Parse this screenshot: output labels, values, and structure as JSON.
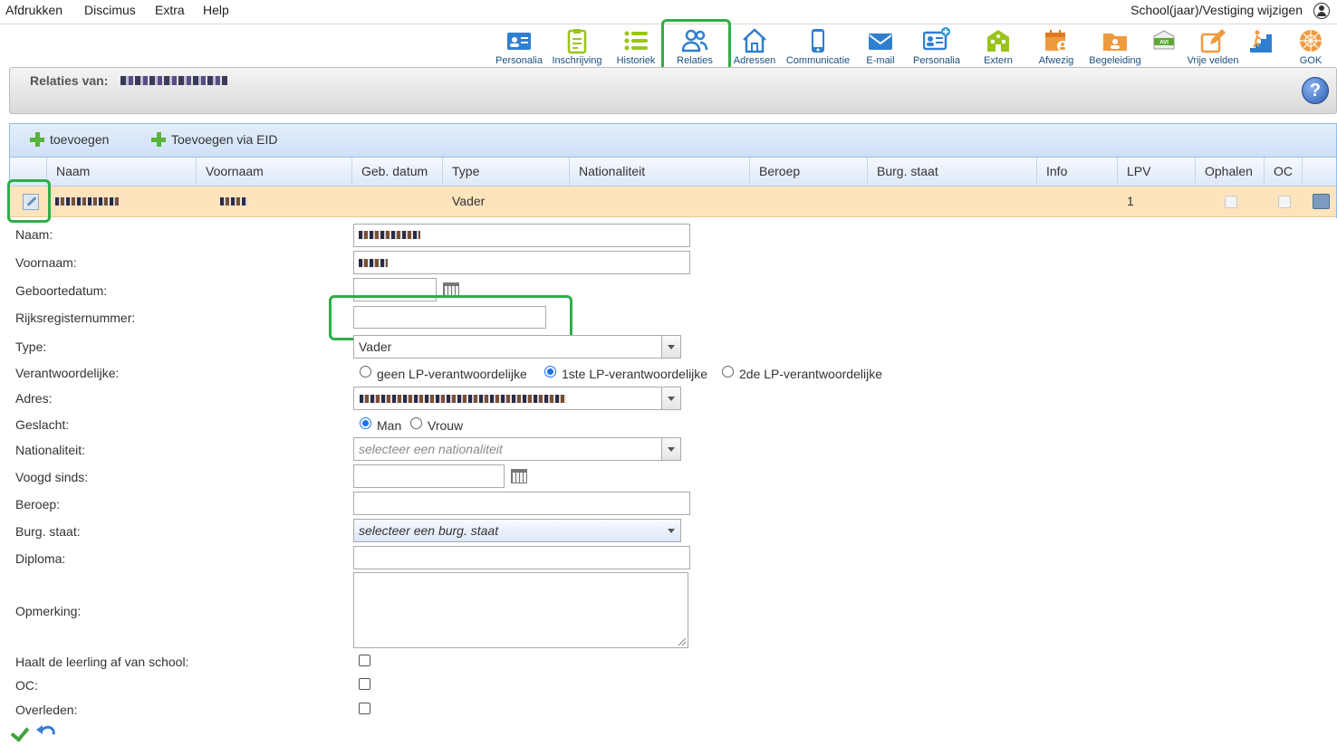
{
  "menu": {
    "items": [
      "Afdrukken",
      "Discimus",
      "Extra",
      "Help"
    ],
    "right": "School(jaar)/Vestiging wijzigen",
    "user_icon": "user-circle-icon"
  },
  "toolbar": [
    {
      "label": "Personalia",
      "icon": "id-card-icon",
      "color": "#2f7fd0"
    },
    {
      "label": "Inschrijving",
      "icon": "clipboard-icon",
      "color": "#9ac41c"
    },
    {
      "label": "Historiek",
      "icon": "list-icon",
      "color": "#9ac41c"
    },
    {
      "label": "Relaties",
      "icon": "people-icon",
      "color": "#2f7fd0"
    },
    {
      "label": "Adressen",
      "icon": "house-icon",
      "color": "#2f7fd0"
    },
    {
      "label": "Communicatie",
      "icon": "phone-icon",
      "color": "#2f7fd0"
    },
    {
      "label": "E-mail",
      "icon": "envelope-icon",
      "color": "#2f7fd0"
    },
    {
      "label": "Personalia",
      "icon": "id-card-plus-icon",
      "color": "#2f7fd0"
    },
    {
      "label": "Extern",
      "icon": "building-icon",
      "color": "#9ac41c"
    },
    {
      "label": "Afwezig",
      "icon": "calendar-person-icon",
      "color": "#f09a3e"
    },
    {
      "label": "Begeleiding",
      "icon": "folder-person-icon",
      "color": "#f09a3e"
    },
    {
      "label": "",
      "icon": "avi-icon",
      "color": "#5aa832"
    },
    {
      "label": "Vrije velden",
      "icon": "edit-pencil-icon",
      "color": "#f09a3e"
    },
    {
      "label": "",
      "icon": "stairs-person-icon",
      "color": "#2f7fd0"
    },
    {
      "label": "GOK",
      "icon": "globe-network-icon",
      "color": "#f09a3e"
    }
  ],
  "relations_header": {
    "title": "Relaties van:"
  },
  "grid": {
    "add_label": "toevoegen",
    "add_eid_label": "Toevoegen via EID",
    "columns": [
      "Naam",
      "Voornaam",
      "Geb. datum",
      "Type",
      "Nationaliteit",
      "Beroep",
      "Burg. staat",
      "Info",
      "LPV",
      "Ophalen",
      "OC"
    ],
    "row": {
      "type": "Vader",
      "lpv": "1"
    }
  },
  "form": {
    "labels": {
      "naam": "Naam:",
      "voornaam": "Voornaam:",
      "geboortedatum": "Geboortedatum:",
      "rijksregisternummer": "Rijksregisternummer:",
      "type": "Type:",
      "verantwoordelijke": "Verantwoordelijke:",
      "adres": "Adres:",
      "geslacht": "Geslacht:",
      "nationaliteit": "Nationaliteit:",
      "voogd_sinds": "Voogd sinds:",
      "beroep": "Beroep:",
      "burg_staat": "Burg. staat:",
      "diploma": "Diploma:",
      "opmerking": "Opmerking:",
      "haalt_af": "Haalt de leerling af van school:",
      "oc": "OC:",
      "overleden": "Overleden:"
    },
    "type_value": "Vader",
    "verantwoordelijke_options": [
      "geen LP-verantwoordelijke",
      "1ste LP-verantwoordelijke",
      "2de LP-verantwoordelijke"
    ],
    "verantwoordelijke_selected": 1,
    "geslacht_options": [
      "Man",
      "Vrouw"
    ],
    "geslacht_selected": 0,
    "nationaliteit_placeholder": "selecteer een nationaliteit",
    "burg_staat_placeholder": "selecteer een burg. staat"
  },
  "colors": {
    "highlight": "#2fae48",
    "row_bg": "#fde4bd",
    "header_bg": "#dde8f7"
  }
}
